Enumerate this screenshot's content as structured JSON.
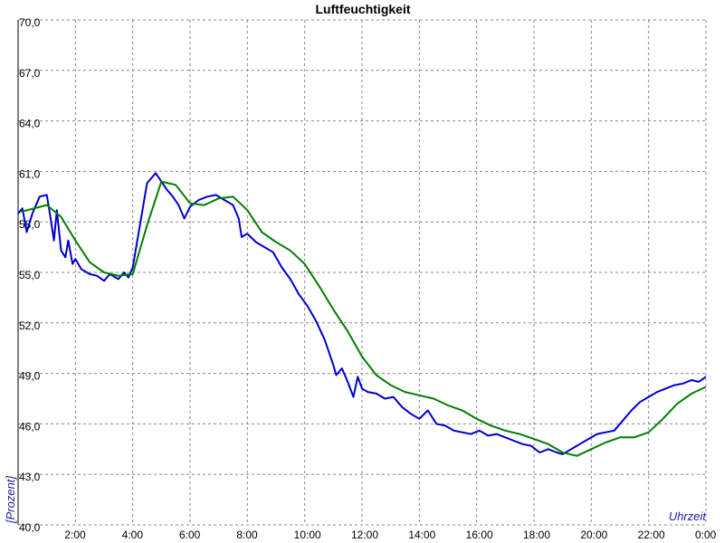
{
  "chart_data": {
    "type": "line",
    "title": "Luftfeuchtigkeit",
    "xlabel": "Uhrzeit",
    "ylabel": "[Prozent]",
    "ylim": [
      40,
      70
    ],
    "xlim": [
      0,
      24
    ],
    "grid": true,
    "x_tick_labels": [
      "2:00",
      "4:00",
      "6:00",
      "8:00",
      "10:00",
      "12:00",
      "14:00",
      "16:00",
      "18:00",
      "20:00",
      "22:00",
      "0:00"
    ],
    "y_tick_labels": [
      "40,0",
      "43,0",
      "46,0",
      "49,0",
      "52,0",
      "55,0",
      "58,0",
      "61,0",
      "64,0",
      "67,0",
      "70,0"
    ],
    "series": [
      {
        "color": "#0000cc",
        "x": [
          0,
          0.15,
          0.3,
          0.5,
          0.75,
          1.0,
          1.1,
          1.25,
          1.35,
          1.5,
          1.65,
          1.75,
          1.9,
          2.0,
          2.2,
          2.5,
          2.75,
          3.0,
          3.2,
          3.5,
          3.7,
          3.85,
          4.0,
          4.25,
          4.5,
          4.8,
          5.0,
          5.2,
          5.4,
          5.6,
          5.8,
          6.0,
          6.3,
          6.6,
          6.9,
          7.2,
          7.5,
          7.7,
          7.8,
          8.0,
          8.3,
          8.6,
          8.9,
          9.2,
          9.5,
          9.8,
          10.1,
          10.4,
          10.7,
          11.0,
          11.1,
          11.3,
          11.5,
          11.7,
          11.85,
          12.0,
          12.2,
          12.5,
          12.8,
          13.1,
          13.4,
          13.7,
          14.0,
          14.3,
          14.6,
          14.9,
          15.2,
          15.5,
          15.8,
          16.1,
          16.4,
          16.7,
          17.0,
          17.3,
          17.6,
          17.9,
          18.2,
          18.5,
          18.8,
          19.0,
          19.3,
          19.6,
          19.9,
          20.2,
          20.5,
          20.8,
          21.1,
          21.4,
          21.7,
          22.0,
          22.3,
          22.6,
          22.9,
          23.2,
          23.5,
          23.75,
          24.0
        ],
        "values": [
          58.5,
          58.8,
          57.4,
          58.5,
          59.5,
          59.6,
          58.6,
          56.9,
          58.7,
          56.3,
          55.9,
          56.9,
          55.5,
          55.8,
          55.2,
          54.9,
          54.8,
          54.5,
          54.9,
          54.6,
          55.0,
          54.7,
          55.3,
          57.8,
          60.3,
          60.9,
          60.4,
          59.9,
          59.5,
          59.0,
          58.2,
          58.9,
          59.3,
          59.5,
          59.6,
          59.3,
          59.0,
          58.2,
          57.1,
          57.3,
          56.8,
          56.5,
          56.2,
          55.3,
          54.6,
          53.7,
          53.0,
          52.1,
          51.0,
          49.5,
          48.9,
          49.3,
          48.5,
          47.6,
          48.8,
          48.1,
          47.9,
          47.8,
          47.5,
          47.6,
          47.0,
          46.6,
          46.3,
          46.8,
          46.0,
          45.9,
          45.6,
          45.5,
          45.4,
          45.6,
          45.3,
          45.4,
          45.2,
          45.0,
          44.8,
          44.7,
          44.3,
          44.5,
          44.3,
          44.2,
          44.5,
          44.8,
          45.1,
          45.4,
          45.5,
          45.6,
          46.2,
          46.8,
          47.3,
          47.6,
          47.9,
          48.1,
          48.3,
          48.4,
          48.6,
          48.5,
          48.8
        ]
      },
      {
        "color": "#007f00",
        "x": [
          0.1,
          1.0,
          1.5,
          2.0,
          2.5,
          3.0,
          3.5,
          4.0,
          4.5,
          5.0,
          5.5,
          6.0,
          6.5,
          7.0,
          7.5,
          8.0,
          8.5,
          9.0,
          9.5,
          10.0,
          10.5,
          11.0,
          11.5,
          12.0,
          12.5,
          13.0,
          13.5,
          14.0,
          14.5,
          15.0,
          15.5,
          16.0,
          16.5,
          17.0,
          17.5,
          18.0,
          18.5,
          19.0,
          19.5,
          20.0,
          20.5,
          21.0,
          21.5,
          22.0,
          22.5,
          23.0,
          23.5,
          24.0
        ],
        "values": [
          58.6,
          59.0,
          58.3,
          56.9,
          55.6,
          55.0,
          54.8,
          54.9,
          57.8,
          60.4,
          60.2,
          59.1,
          59.0,
          59.4,
          59.5,
          58.7,
          57.4,
          56.8,
          56.3,
          55.5,
          54.2,
          52.8,
          51.5,
          50.0,
          48.9,
          48.3,
          47.9,
          47.7,
          47.5,
          47.1,
          46.8,
          46.3,
          45.9,
          45.6,
          45.4,
          45.1,
          44.8,
          44.3,
          44.1,
          44.5,
          44.9,
          45.2,
          45.2,
          45.5,
          46.3,
          47.2,
          47.8,
          48.2
        ]
      }
    ]
  }
}
